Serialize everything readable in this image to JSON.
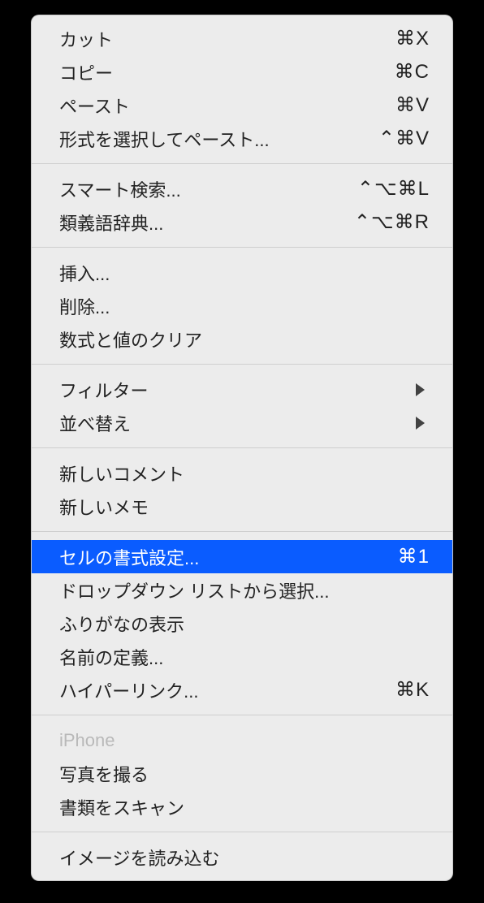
{
  "groups": [
    {
      "items": [
        {
          "label": "カット",
          "shortcut": "⌘X",
          "interactable": true,
          "submenu": false,
          "highlighted": false,
          "disabled": false,
          "name": "menu-item-cut"
        },
        {
          "label": "コピー",
          "shortcut": "⌘C",
          "interactable": true,
          "submenu": false,
          "highlighted": false,
          "disabled": false,
          "name": "menu-item-copy"
        },
        {
          "label": "ペースト",
          "shortcut": "⌘V",
          "interactable": true,
          "submenu": false,
          "highlighted": false,
          "disabled": false,
          "name": "menu-item-paste"
        },
        {
          "label": "形式を選択してペースト...",
          "shortcut": "⌃⌘V",
          "interactable": true,
          "submenu": false,
          "highlighted": false,
          "disabled": false,
          "name": "menu-item-paste-special"
        }
      ]
    },
    {
      "items": [
        {
          "label": "スマート検索...",
          "shortcut": "⌃⌥⌘L",
          "interactable": true,
          "submenu": false,
          "highlighted": false,
          "disabled": false,
          "name": "menu-item-smart-lookup"
        },
        {
          "label": "類義語辞典...",
          "shortcut": "⌃⌥⌘R",
          "interactable": true,
          "submenu": false,
          "highlighted": false,
          "disabled": false,
          "name": "menu-item-thesaurus"
        }
      ]
    },
    {
      "items": [
        {
          "label": "挿入...",
          "shortcut": "",
          "interactable": true,
          "submenu": false,
          "highlighted": false,
          "disabled": false,
          "name": "menu-item-insert"
        },
        {
          "label": "削除...",
          "shortcut": "",
          "interactable": true,
          "submenu": false,
          "highlighted": false,
          "disabled": false,
          "name": "menu-item-delete"
        },
        {
          "label": "数式と値のクリア",
          "shortcut": "",
          "interactable": true,
          "submenu": false,
          "highlighted": false,
          "disabled": false,
          "name": "menu-item-clear-contents"
        }
      ]
    },
    {
      "items": [
        {
          "label": "フィルター",
          "shortcut": "",
          "interactable": true,
          "submenu": true,
          "highlighted": false,
          "disabled": false,
          "name": "menu-item-filter"
        },
        {
          "label": "並べ替え",
          "shortcut": "",
          "interactable": true,
          "submenu": true,
          "highlighted": false,
          "disabled": false,
          "name": "menu-item-sort"
        }
      ]
    },
    {
      "items": [
        {
          "label": "新しいコメント",
          "shortcut": "",
          "interactable": true,
          "submenu": false,
          "highlighted": false,
          "disabled": false,
          "name": "menu-item-new-comment"
        },
        {
          "label": "新しいメモ",
          "shortcut": "",
          "interactable": true,
          "submenu": false,
          "highlighted": false,
          "disabled": false,
          "name": "menu-item-new-note"
        }
      ]
    },
    {
      "items": [
        {
          "label": "セルの書式設定...",
          "shortcut": "⌘1",
          "interactable": true,
          "submenu": false,
          "highlighted": true,
          "disabled": false,
          "name": "menu-item-format-cells"
        },
        {
          "label": "ドロップダウン リストから選択...",
          "shortcut": "",
          "interactable": true,
          "submenu": false,
          "highlighted": false,
          "disabled": false,
          "name": "menu-item-pick-from-dropdown"
        },
        {
          "label": "ふりがなの表示",
          "shortcut": "",
          "interactable": true,
          "submenu": false,
          "highlighted": false,
          "disabled": false,
          "name": "menu-item-show-phonetic"
        },
        {
          "label": "名前の定義...",
          "shortcut": "",
          "interactable": true,
          "submenu": false,
          "highlighted": false,
          "disabled": false,
          "name": "menu-item-define-name"
        },
        {
          "label": "ハイパーリンク...",
          "shortcut": "⌘K",
          "interactable": true,
          "submenu": false,
          "highlighted": false,
          "disabled": false,
          "name": "menu-item-hyperlink"
        }
      ]
    },
    {
      "items": [
        {
          "label": "iPhone",
          "shortcut": "",
          "interactable": false,
          "submenu": false,
          "highlighted": false,
          "disabled": true,
          "name": "menu-item-iphone-header"
        },
        {
          "label": "写真を撮る",
          "shortcut": "",
          "interactable": true,
          "submenu": false,
          "highlighted": false,
          "disabled": false,
          "name": "menu-item-take-photo"
        },
        {
          "label": "書類をスキャン",
          "shortcut": "",
          "interactable": true,
          "submenu": false,
          "highlighted": false,
          "disabled": false,
          "name": "menu-item-scan-documents"
        }
      ]
    },
    {
      "items": [
        {
          "label": "イメージを読み込む",
          "shortcut": "",
          "interactable": true,
          "submenu": false,
          "highlighted": false,
          "disabled": false,
          "name": "menu-item-import-image"
        }
      ]
    }
  ]
}
